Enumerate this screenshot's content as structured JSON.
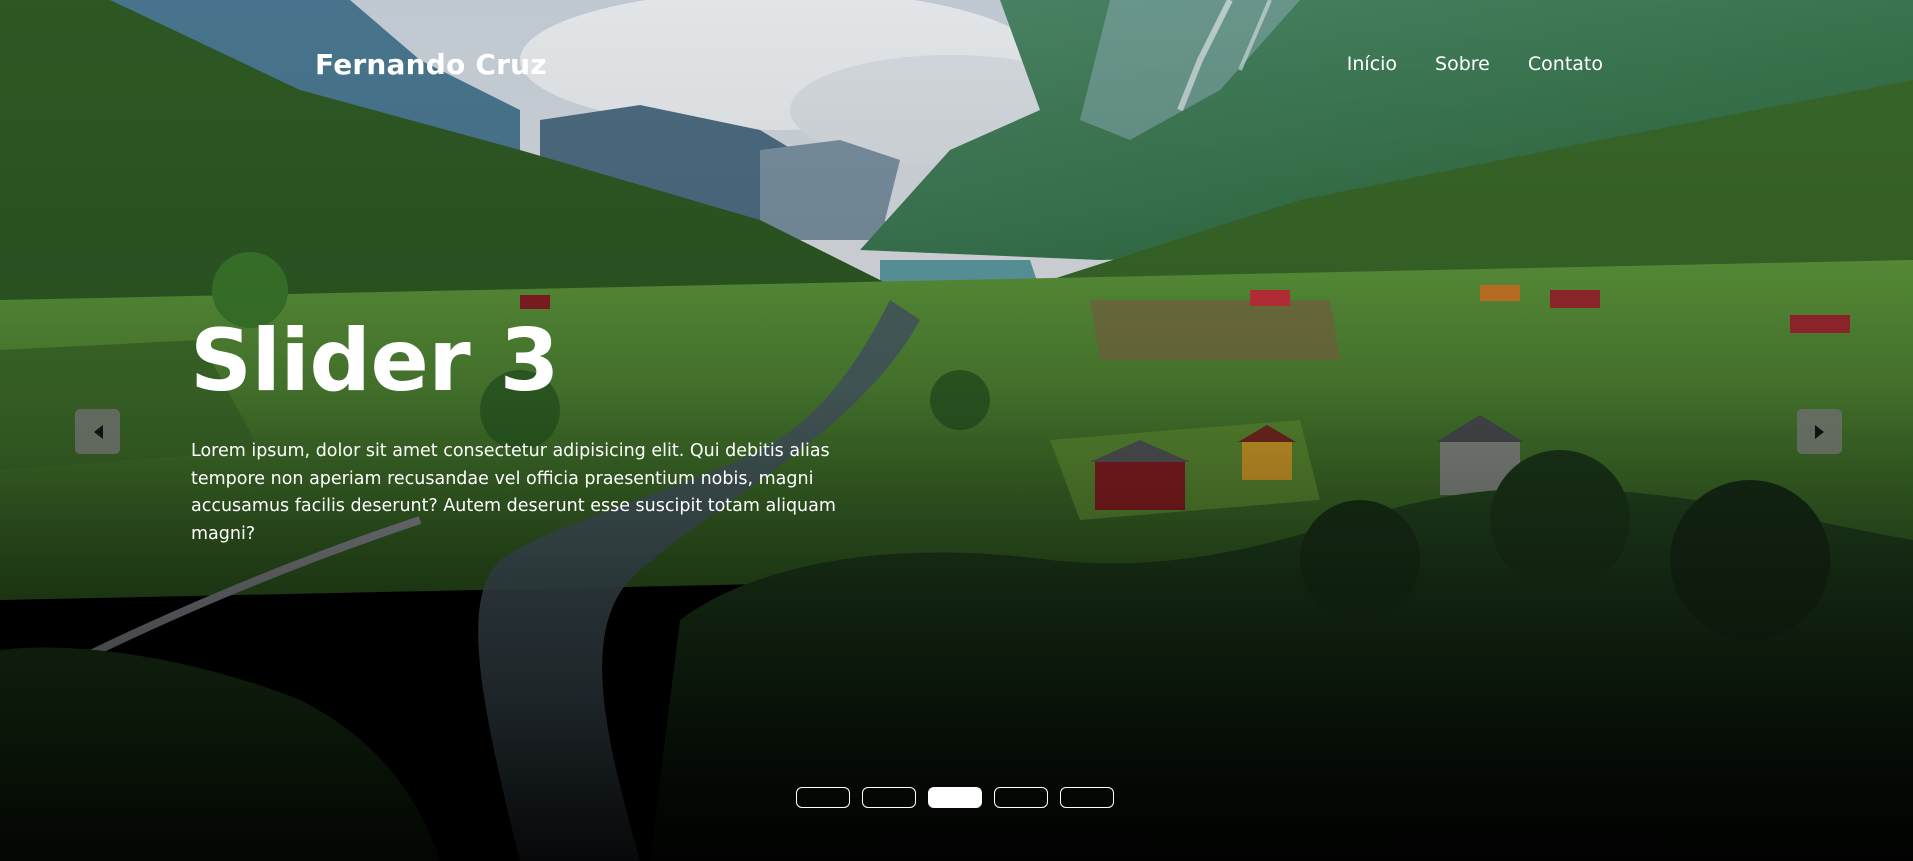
{
  "header": {
    "logo": "Fernando Cruz",
    "nav": [
      {
        "label": "Início"
      },
      {
        "label": "Sobre"
      },
      {
        "label": "Contato"
      }
    ]
  },
  "slide": {
    "title": "Slider 3",
    "text": "Lorem ipsum, dolor sit amet consectetur adipisicing elit. Qui debitis alias tempore non aperiam recusandae vel officia praesentium nobis, magni accusamus facilis deserunt? Autem deserunt esse suscipit totam aliquam magni?"
  },
  "carousel": {
    "slide_count": 5,
    "active_index": 2,
    "prev_icon": "caret-left-icon",
    "next_icon": "caret-right-icon"
  },
  "colors": {
    "text": "#ffffff",
    "arrow_bg": "#6e6e6e",
    "dot_active": "#ffffff"
  }
}
